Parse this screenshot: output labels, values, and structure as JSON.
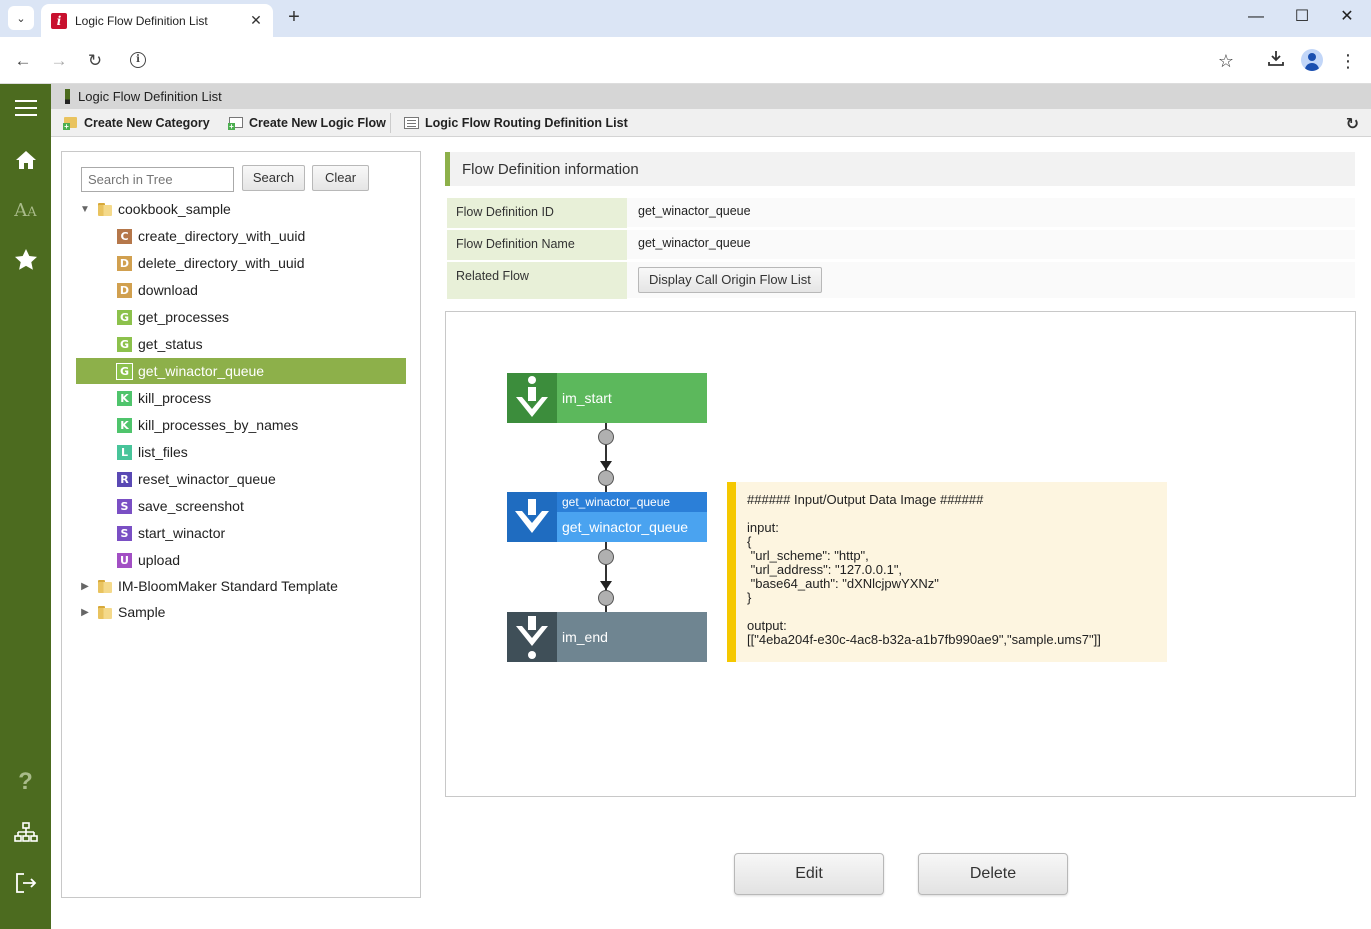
{
  "browser": {
    "tab_title": "Logic Flow Definition List",
    "new_tab": "+",
    "minimize": "—",
    "maximize": "☐",
    "close": "✕"
  },
  "page": {
    "title": "Logic Flow Definition List"
  },
  "toolbar": {
    "create_category": "Create New Category",
    "create_logic_flow": "Create New Logic Flow",
    "routing_list": "Logic Flow Routing Definition List"
  },
  "tree": {
    "search_placeholder": "Search in Tree",
    "search_label": "Search",
    "clear_label": "Clear",
    "root_folders": [
      {
        "label": "cookbook_sample"
      },
      {
        "label": "IM-BloomMaker Standard Template"
      },
      {
        "label": "Sample"
      }
    ],
    "items": [
      {
        "badge": "C",
        "label": "create_directory_with_uuid",
        "color": "#b5774a"
      },
      {
        "badge": "D",
        "label": "delete_directory_with_uuid",
        "color": "#d1a04f"
      },
      {
        "badge": "D",
        "label": "download",
        "color": "#d1a04f"
      },
      {
        "badge": "G",
        "label": "get_processes",
        "color": "#8cc14c"
      },
      {
        "badge": "G",
        "label": "get_status",
        "color": "#8cc14c"
      },
      {
        "badge": "G",
        "label": "get_winactor_queue",
        "color": "#8cc14c"
      },
      {
        "badge": "K",
        "label": "kill_process",
        "color": "#4fc46c"
      },
      {
        "badge": "K",
        "label": "kill_processes_by_names",
        "color": "#4fc46c"
      },
      {
        "badge": "L",
        "label": "list_files",
        "color": "#48c49a"
      },
      {
        "badge": "R",
        "label": "reset_winactor_queue",
        "color": "#5a49b4"
      },
      {
        "badge": "S",
        "label": "save_screenshot",
        "color": "#7a4fc4"
      },
      {
        "badge": "S",
        "label": "start_winactor",
        "color": "#7a4fc4"
      },
      {
        "badge": "U",
        "label": "upload",
        "color": "#a24fc4"
      }
    ]
  },
  "detail": {
    "section_title": "Flow Definition information",
    "id_label": "Flow Definition ID",
    "id_value": "get_winactor_queue",
    "name_label": "Flow Definition Name",
    "name_value": "get_winactor_queue",
    "related_label": "Related Flow",
    "related_button": "Display Call Origin Flow List"
  },
  "flow": {
    "start_label": "im_start",
    "task_title": "get_winactor_queue",
    "task_label": "get_winactor_queue",
    "end_label": "im_end",
    "note": "###### Input/Output Data Image ######\n\ninput:\n{\n \"url_scheme\": \"http\",\n \"url_address\": \"127.0.0.1\",\n \"base64_auth\": \"dXNlcjpwYXNz\"\n}\n\noutput:\n[[\"4eba204f-e30c-4ac8-b32a-a1b7fb990ae9\",\"sample.ums7\"]]"
  },
  "actions": {
    "edit": "Edit",
    "delete": "Delete"
  },
  "colors": {
    "sidebar": "#4c6b1f",
    "accent": "#8db04a",
    "start_node": "#5cb85c",
    "task_node": "#2b7fd8",
    "end_node": "#6f8591",
    "note_border": "#f5c800"
  }
}
